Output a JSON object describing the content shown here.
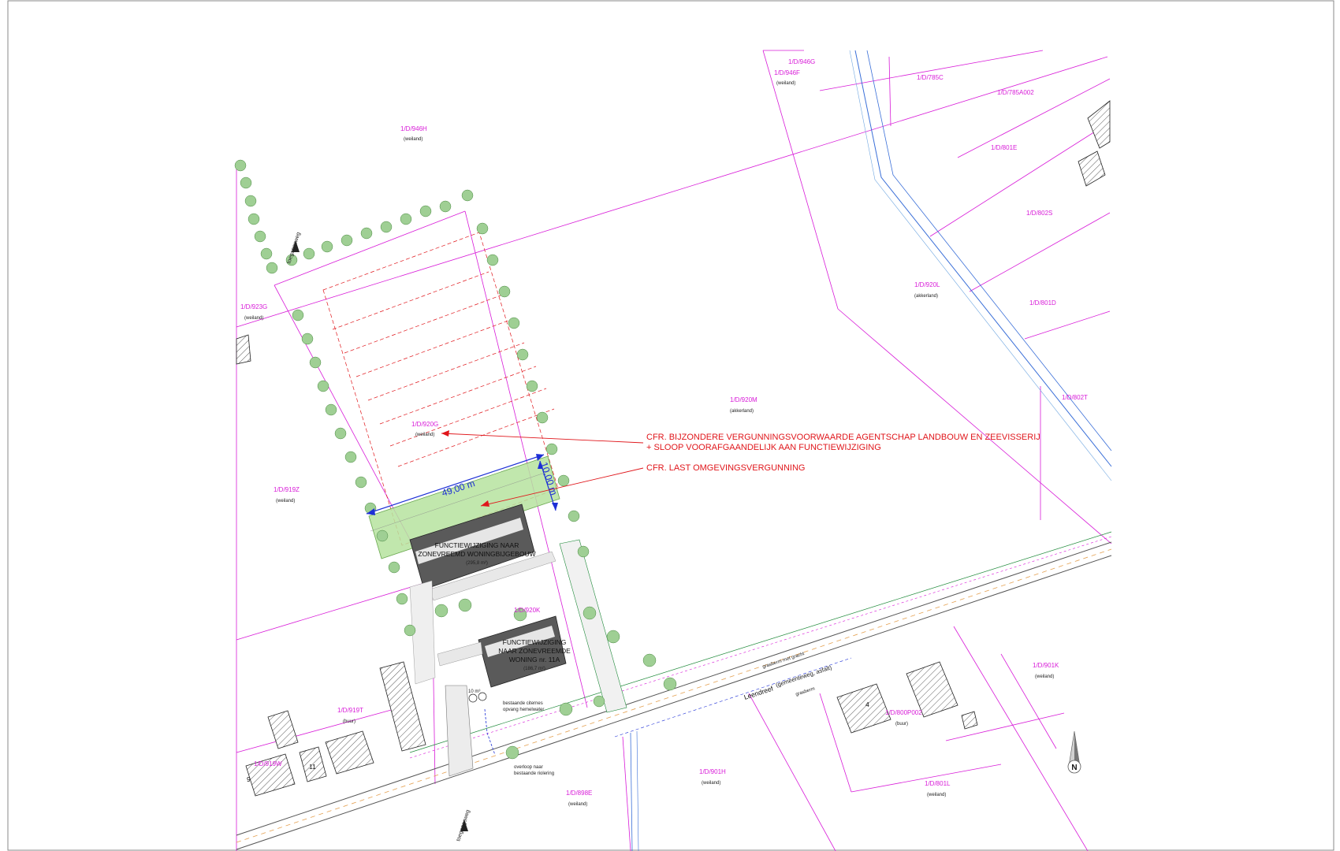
{
  "parcels": {
    "p946g": {
      "id": "1/D/946G"
    },
    "p946f": {
      "id": "1/D/946F",
      "use": "(weiland)"
    },
    "p785c": {
      "id": "1/D/785C"
    },
    "p785a002": {
      "id": "1/D/785A002"
    },
    "p946h": {
      "id": "1/D/946H",
      "use": "(weiland)"
    },
    "p801e": {
      "id": "1/D/801E"
    },
    "p802s": {
      "id": "1/D/802S"
    },
    "p920l": {
      "id": "1/D/920L",
      "use": "(akkerland)"
    },
    "p801d": {
      "id": "1/D/801D"
    },
    "p923g": {
      "id": "1/D/923G",
      "use": "(weiland)"
    },
    "p802t": {
      "id": "1/D/802T"
    },
    "p920m": {
      "id": "1/D/920M",
      "use": "(akkerland)"
    },
    "p920g": {
      "id": "1/D/920G",
      "use": "(weiland)"
    },
    "p919z": {
      "id": "1/D/919Z",
      "use": "(weiland)"
    },
    "p920k": {
      "id": "1/D/920K"
    },
    "p901k": {
      "id": "1/D/901K",
      "use": "(weiland)"
    },
    "p919t": {
      "id": "1/D/919T",
      "use": "(buur)"
    },
    "p800p002": {
      "id": "1/D/800P002",
      "use": "(buur)"
    },
    "p919w": {
      "id": "1/D/919W"
    },
    "p901h": {
      "id": "1/D/901H",
      "use": "(weiland)"
    },
    "p801l": {
      "id": "1/D/801L",
      "use": "(weiland)"
    },
    "p898e": {
      "id": "1/D/898E",
      "use": "(weiland)"
    }
  },
  "notes": {
    "note1_line1": "CFR. BIJZONDERE VERGUNNINGSVOORWAARDE AGENTSCHAP LANDBOUW EN ZEEVISSERIJ",
    "note1_line2": "+ SLOOP VOORAFGAANDELIJK AAN FUNCTIEWIJZIGING",
    "note2": "CFR. LAST OMGEVINGSVERGUNNING"
  },
  "dimensions": {
    "width": "49,00 m",
    "depth": "10,00 m"
  },
  "buildings": {
    "outbuilding": {
      "line1": "FUNCTIEWIJZIGING NAAR",
      "line2": "ZONEVREEMD WONINGBIJGEBOUW",
      "area": "(295,8 m²)"
    },
    "house": {
      "line1": "FUNCTIEWIJZIGING",
      "line2": "NAAR ZONEVREEMDE",
      "line3": "WONING nr. 11A",
      "area": "(186,7 m²)"
    }
  },
  "street": {
    "name": "Leendreef",
    "type": "(gemeenteweg, asfalt)",
    "verge_top": "grasberm met gracht",
    "verge_bottom": "grasberm"
  },
  "utilities": {
    "cistern_line1": "bestaande citernes",
    "cistern_line2": "opvang hemelwater",
    "overflow_line1": "overloop naar",
    "overflow_line2": "bestaande riolering",
    "cistern_volume": "10 m³"
  },
  "access": {
    "top": "toegangsweg",
    "bottom": "toegangsweg"
  },
  "house_numbers": {
    "n4": "4",
    "n11": "11",
    "n9": "9"
  },
  "north_arrow": {
    "label": "N"
  },
  "colors": {
    "parcel_line": "#d81bd8",
    "annotation": "#e0161b",
    "dimension": "#1d2fd6",
    "zone_green": "#b6e39f",
    "building": "#555555"
  }
}
